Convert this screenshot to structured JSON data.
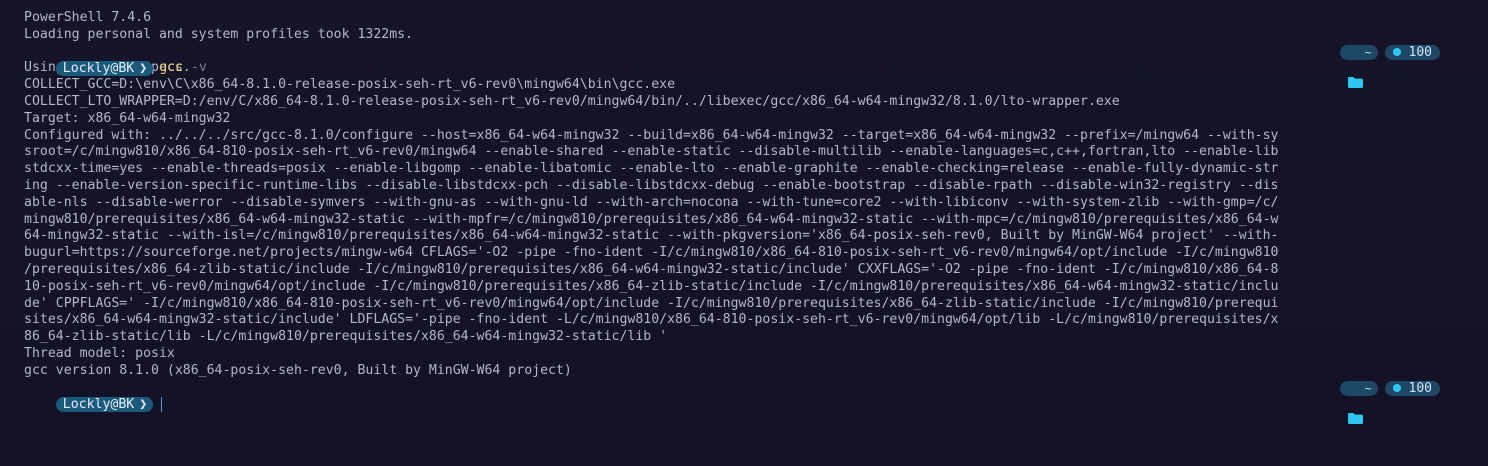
{
  "header": {
    "version_line": "PowerShell 7.4.6",
    "loading_line": "Loading personal and system profiles took 1322ms."
  },
  "prompt": {
    "user": "Lockly@BK",
    "chevron": "❯",
    "folder": "~",
    "battery": "100"
  },
  "command": {
    "name": "gcc",
    "arg": "-v"
  },
  "output": [
    "Using built-in specs.",
    "COLLECT_GCC=D:\\env\\C\\x86_64-8.1.0-release-posix-seh-rt_v6-rev0\\mingw64\\bin\\gcc.exe",
    "COLLECT_LTO_WRAPPER=D:/env/C/x86_64-8.1.0-release-posix-seh-rt_v6-rev0/mingw64/bin/../libexec/gcc/x86_64-w64-mingw32/8.1.0/lto-wrapper.exe",
    "Target: x86_64-w64-mingw32",
    "Configured with: ../../../src/gcc-8.1.0/configure --host=x86_64-w64-mingw32 --build=x86_64-w64-mingw32 --target=x86_64-w64-mingw32 --prefix=/mingw64 --with-sy",
    "sroot=/c/mingw810/x86_64-810-posix-seh-rt_v6-rev0/mingw64 --enable-shared --enable-static --disable-multilib --enable-languages=c,c++,fortran,lto --enable-lib",
    "stdcxx-time=yes --enable-threads=posix --enable-libgomp --enable-libatomic --enable-lto --enable-graphite --enable-checking=release --enable-fully-dynamic-str",
    "ing --enable-version-specific-runtime-libs --disable-libstdcxx-pch --disable-libstdcxx-debug --enable-bootstrap --disable-rpath --disable-win32-registry --dis",
    "able-nls --disable-werror --disable-symvers --with-gnu-as --with-gnu-ld --with-arch=nocona --with-tune=core2 --with-libiconv --with-system-zlib --with-gmp=/c/",
    "mingw810/prerequisites/x86_64-w64-mingw32-static --with-mpfr=/c/mingw810/prerequisites/x86_64-w64-mingw32-static --with-mpc=/c/mingw810/prerequisites/x86_64-w",
    "64-mingw32-static --with-isl=/c/mingw810/prerequisites/x86_64-w64-mingw32-static --with-pkgversion='x86_64-posix-seh-rev0, Built by MinGW-W64 project' --with-",
    "bugurl=https://sourceforge.net/projects/mingw-w64 CFLAGS='-O2 -pipe -fno-ident -I/c/mingw810/x86_64-810-posix-seh-rt_v6-rev0/mingw64/opt/include -I/c/mingw810",
    "/prerequisites/x86_64-zlib-static/include -I/c/mingw810/prerequisites/x86_64-w64-mingw32-static/include' CXXFLAGS='-O2 -pipe -fno-ident -I/c/mingw810/x86_64-8",
    "10-posix-seh-rt_v6-rev0/mingw64/opt/include -I/c/mingw810/prerequisites/x86_64-zlib-static/include -I/c/mingw810/prerequisites/x86_64-w64-mingw32-static/inclu",
    "de' CPPFLAGS=' -I/c/mingw810/x86_64-810-posix-seh-rt_v6-rev0/mingw64/opt/include -I/c/mingw810/prerequisites/x86_64-zlib-static/include -I/c/mingw810/prerequi",
    "sites/x86_64-w64-mingw32-static/include' LDFLAGS='-pipe -fno-ident -L/c/mingw810/x86_64-810-posix-seh-rt_v6-rev0/mingw64/opt/lib -L/c/mingw810/prerequisites/x",
    "86_64-zlib-static/lib -L/c/mingw810/prerequisites/x86_64-w64-mingw32-static/lib '",
    "Thread model: posix",
    "gcc version 8.1.0 (x86_64-posix-seh-rev0, Built by MinGW-W64 project)"
  ],
  "colors": {
    "background": "#141428",
    "text": "#b5b7c9",
    "prompt_bg": "#1b5a7a",
    "command": "#f0d27a",
    "segment_bg": "#1f4766",
    "battery_dot": "#2fc6ef"
  },
  "icons": [
    "folder-icon",
    "battery-dot-icon",
    "chevron-icon"
  ]
}
